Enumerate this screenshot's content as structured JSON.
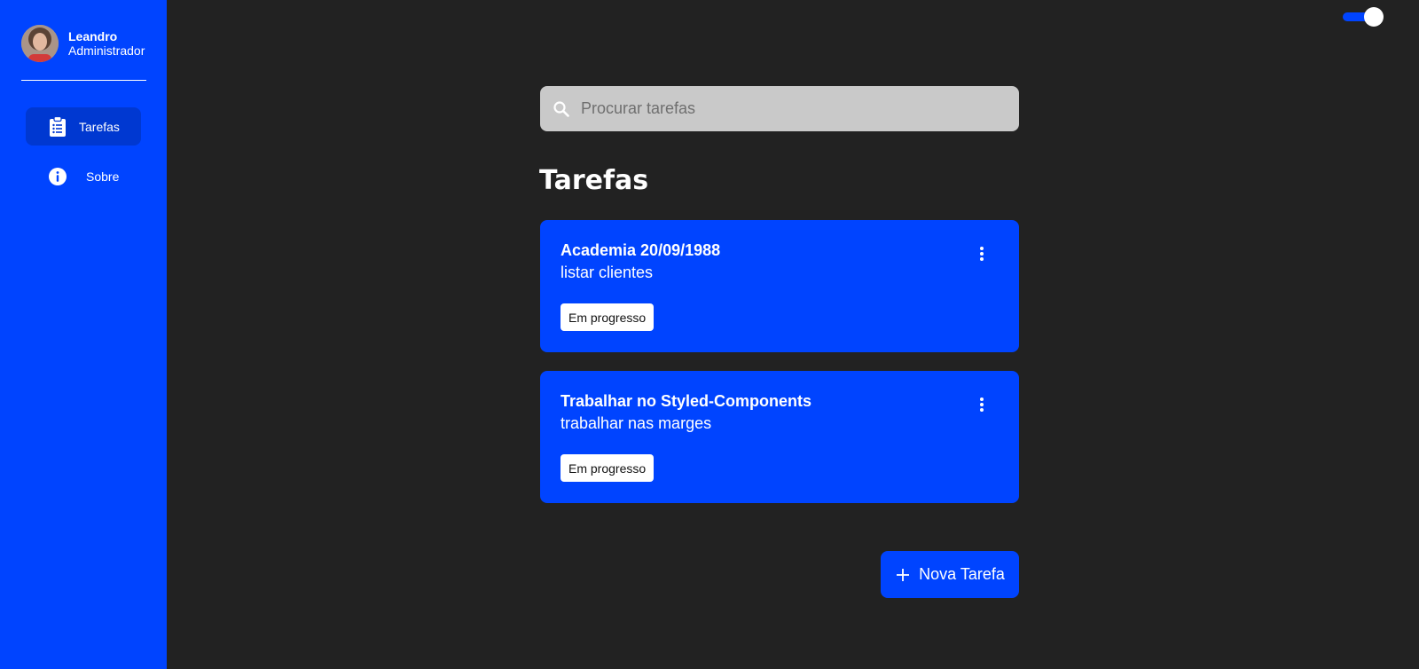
{
  "user": {
    "name": "Leandro",
    "role": "Administrador"
  },
  "sidebar": {
    "items": [
      {
        "label": "Tarefas",
        "icon": "clipboard-list-icon",
        "active": true
      },
      {
        "label": "Sobre",
        "icon": "info-icon",
        "active": false
      }
    ]
  },
  "theme_toggle": {
    "on": true
  },
  "search": {
    "placeholder": "Procurar tarefas",
    "value": ""
  },
  "main": {
    "title": "Tarefas"
  },
  "tasks": [
    {
      "title": "Academia 20/09/1988",
      "description": "listar clientes",
      "status": "Em progresso"
    },
    {
      "title": "Trabalhar no Styled-Components",
      "description": "trabalhar nas marges",
      "status": "Em progresso"
    }
  ],
  "actions": {
    "new_task_label": "Nova Tarefa"
  },
  "colors": {
    "accent": "#0044ff",
    "sidebar_active": "#0038d1",
    "background": "#222222",
    "search_bg": "#c9c9c9"
  }
}
